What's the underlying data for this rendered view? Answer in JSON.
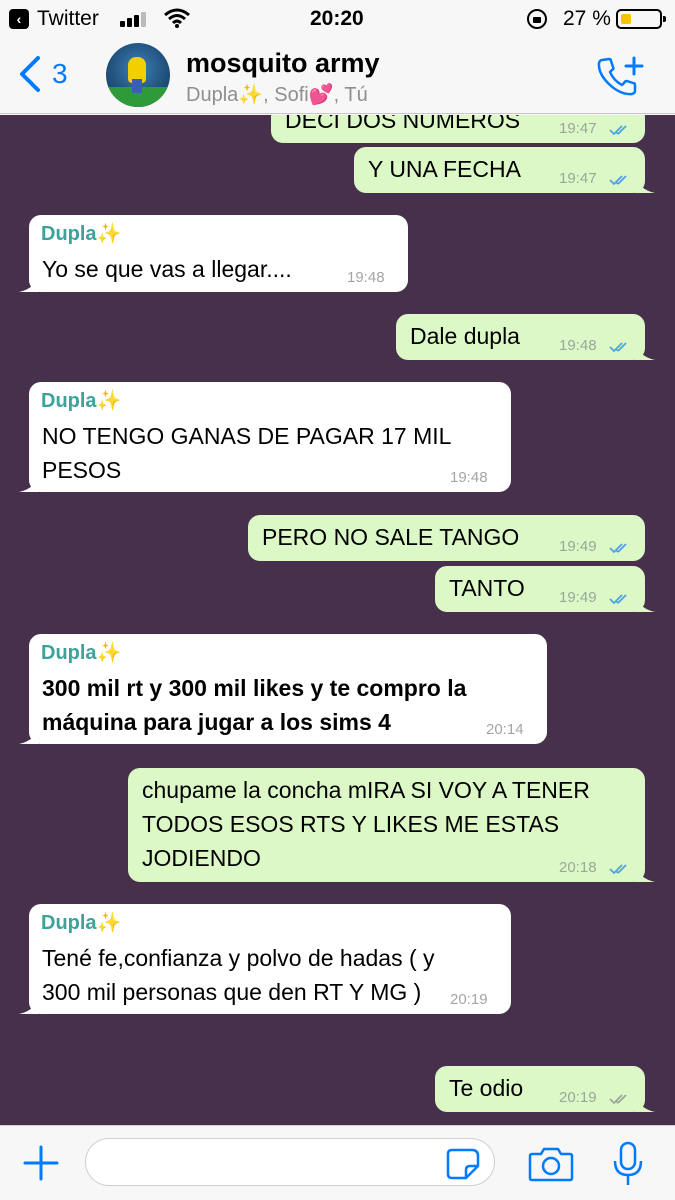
{
  "status_bar": {
    "back_app": "Twitter",
    "time": "20:20",
    "battery_percent": "27 %"
  },
  "header": {
    "back_count": "3",
    "group_name": "mosquito army",
    "members": "Dupla✨, Sofi💕, Tú"
  },
  "messages": [
    {
      "dir": "out",
      "text": "DECÍ DOS NÚMEROS",
      "time": "19:47",
      "ticks": "read"
    },
    {
      "dir": "out",
      "text": "Y UNA FECHA",
      "time": "19:47",
      "ticks": "read"
    },
    {
      "dir": "in",
      "sender": "Dupla✨",
      "text": "Yo se que vas a llegar....",
      "time": "19:48"
    },
    {
      "dir": "out",
      "text": "Dale dupla",
      "time": "19:48",
      "ticks": "read"
    },
    {
      "dir": "in",
      "sender": "Dupla✨",
      "text": "NO TENGO GANAS DE PAGAR 17 MIL\nPESOS",
      "time": "19:48"
    },
    {
      "dir": "out",
      "text": "PERO NO SALE TANGO",
      "time": "19:49",
      "ticks": "read"
    },
    {
      "dir": "out",
      "text": "TANTO",
      "time": "19:49",
      "ticks": "read"
    },
    {
      "dir": "in",
      "sender": "Dupla✨",
      "text": "300 mil rt y 300 mil likes y te compro la\nmáquina para jugar a los sims 4",
      "time": "20:14",
      "bold": true
    },
    {
      "dir": "out",
      "text": "chupame la concha mIRA SI VOY A TENER\nTODOS ESOS RTS Y LIKES ME ESTAS\nJODIENDO",
      "time": "20:18",
      "ticks": "read"
    },
    {
      "dir": "in",
      "sender": "Dupla✨",
      "text": "Tené fe,confianza y polvo de hadas ( y\n300 mil personas que den RT Y MG )",
      "time": "20:19"
    },
    {
      "dir": "out",
      "text": "Te odio",
      "time": "20:19",
      "ticks": "delivered"
    }
  ],
  "input": {
    "placeholder": ""
  },
  "icons": {
    "back": "chevron-left-icon",
    "add_call": "phone-add-icon",
    "plus": "plus-icon",
    "sticker": "sticker-icon",
    "camera": "camera-icon",
    "mic": "microphone-icon"
  },
  "colors": {
    "accent": "#007aff",
    "chat_background": "#47304c",
    "outgoing_bubble": "#dcf8c6",
    "incoming_bubble": "#ffffff",
    "sender_name": "#3aa39a",
    "read_ticks": "#4fa3e0"
  }
}
